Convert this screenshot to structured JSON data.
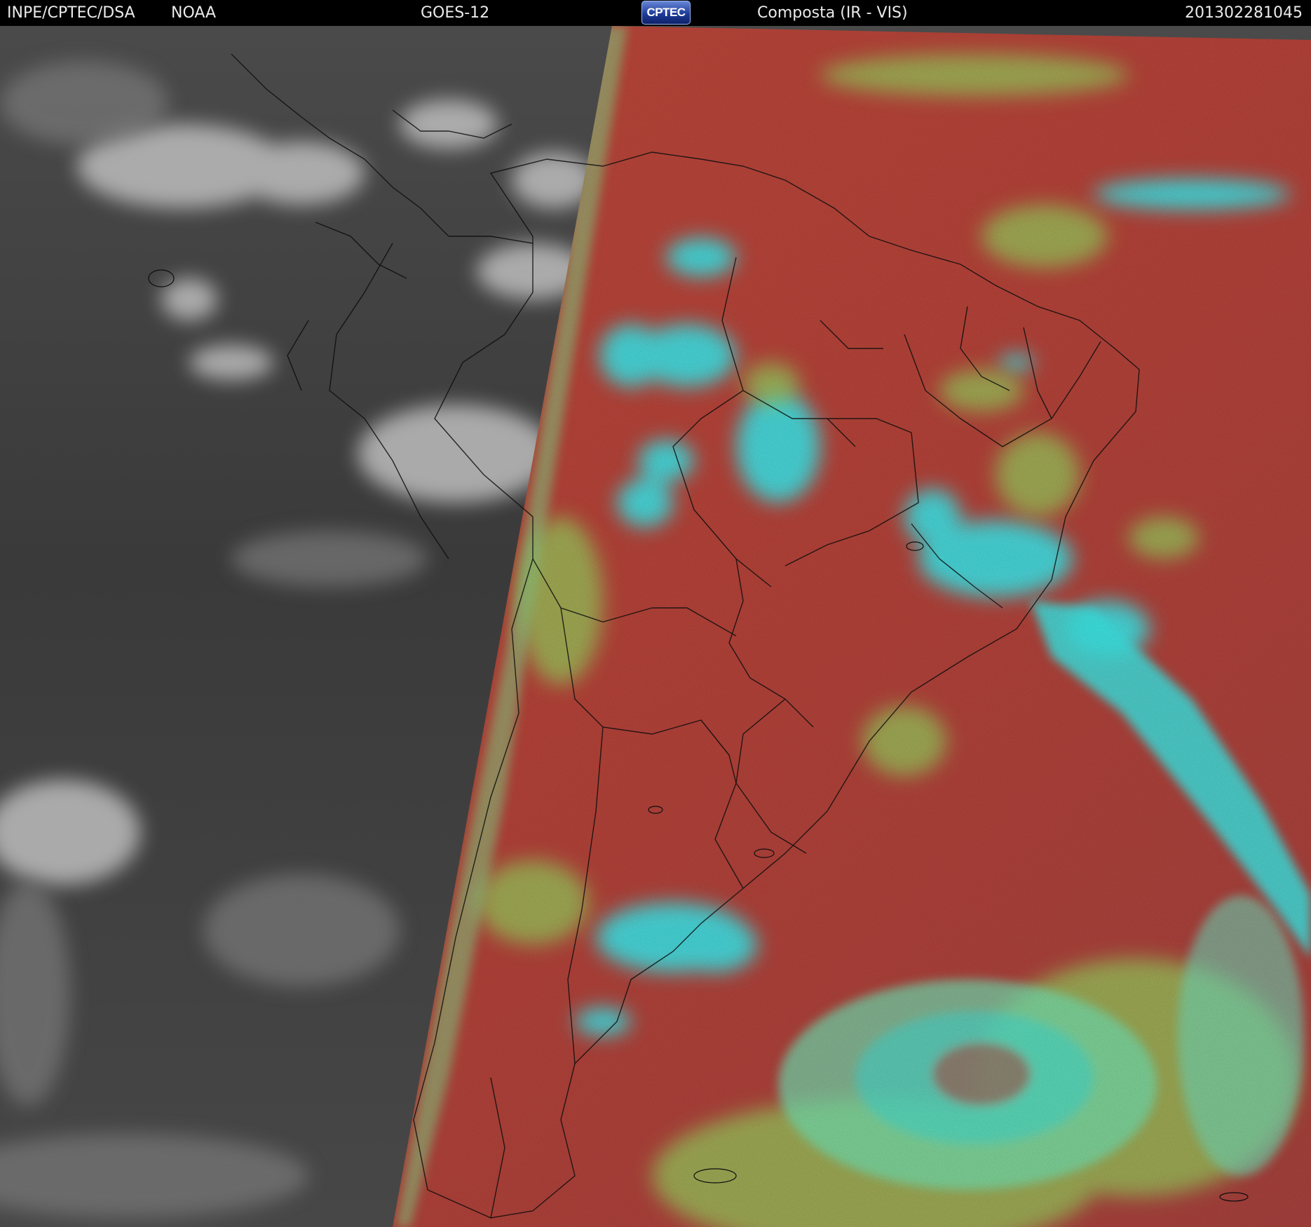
{
  "header": {
    "institution": "INPE/CPTEC/DSA",
    "agency": "NOAA",
    "satellite": "GOES-12",
    "logo_text": "CPTEC",
    "product": "Composta (IR - VIS)",
    "timestamp": "201302281045"
  },
  "colors": {
    "background": "#000000",
    "night_side": "#3c3c3c",
    "day_side_land": "#b8443a",
    "cloud_ir_cyan": "#40f0f0",
    "cloud_green": "#9ad860",
    "border_lines": "#111111"
  }
}
